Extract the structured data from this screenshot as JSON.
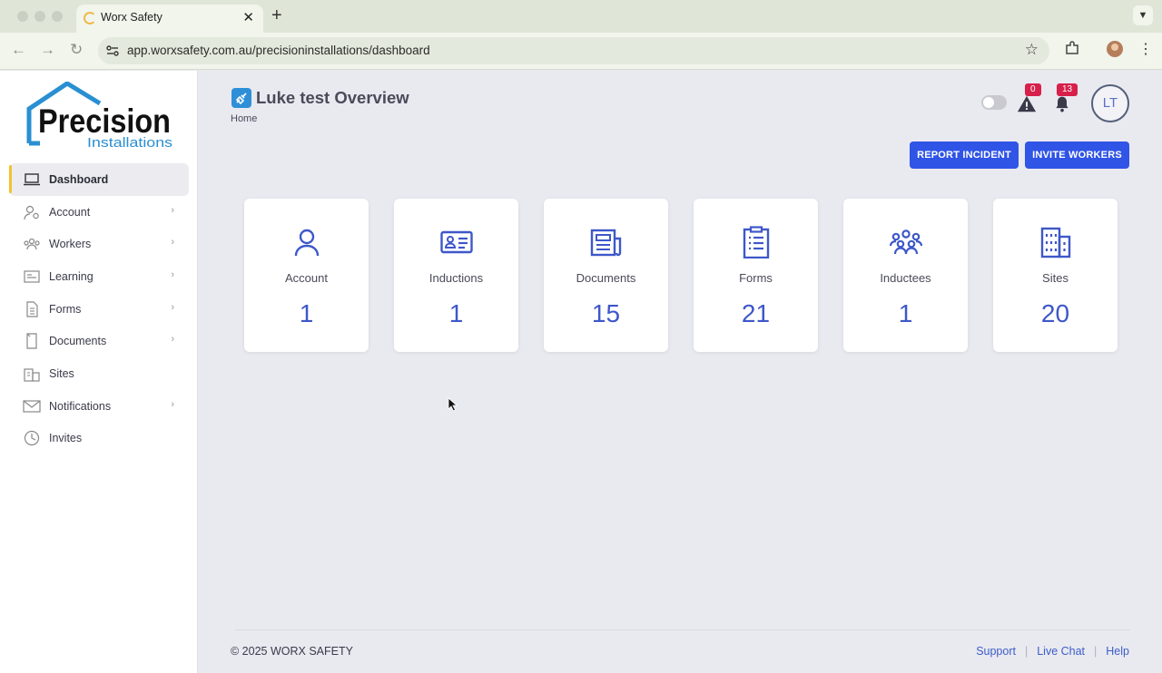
{
  "browser": {
    "tab_title": "Worx Safety",
    "url": "app.worxsafety.com.au/precisioninstallations/dashboard"
  },
  "sidebar": {
    "items": [
      {
        "label": "Dashboard",
        "icon": "laptop-icon",
        "chevron": false,
        "active": true
      },
      {
        "label": "Account",
        "icon": "user-gear-icon",
        "chevron": true
      },
      {
        "label": "Workers",
        "icon": "workers-icon",
        "chevron": true
      },
      {
        "label": "Learning",
        "icon": "learning-icon",
        "chevron": true
      },
      {
        "label": "Forms",
        "icon": "form-icon",
        "chevron": true
      },
      {
        "label": "Documents",
        "icon": "document-icon",
        "chevron": true
      },
      {
        "label": "Sites",
        "icon": "building-icon",
        "chevron": false
      },
      {
        "label": "Notifications",
        "icon": "mail-icon",
        "chevron": true
      },
      {
        "label": "Invites",
        "icon": "clock-icon",
        "chevron": false
      }
    ]
  },
  "header": {
    "title": "Luke test Overview",
    "breadcrumb": "Home",
    "alerts_count": "0",
    "notifications_count": "13",
    "avatar_initials": "LT"
  },
  "actions": {
    "report_incident": "REPORT INCIDENT",
    "invite_workers": "INVITE WORKERS"
  },
  "stats": [
    {
      "label": "Account",
      "value": "1",
      "icon": "person-icon"
    },
    {
      "label": "Inductions",
      "value": "1",
      "icon": "id-card-icon"
    },
    {
      "label": "Documents",
      "value": "15",
      "icon": "newspaper-icon"
    },
    {
      "label": "Forms",
      "value": "21",
      "icon": "clipboard-icon"
    },
    {
      "label": "Inductees",
      "value": "1",
      "icon": "group-icon"
    },
    {
      "label": "Sites",
      "value": "20",
      "icon": "building-icon"
    }
  ],
  "footer": {
    "copyright": "© 2025 WORX SAFETY",
    "links": [
      "Support",
      "Live Chat",
      "Help"
    ]
  },
  "colors": {
    "accent": "#2f54e6",
    "stat_value": "#3e57c9",
    "badge": "#d7204a",
    "active_marker": "#f2c230"
  }
}
